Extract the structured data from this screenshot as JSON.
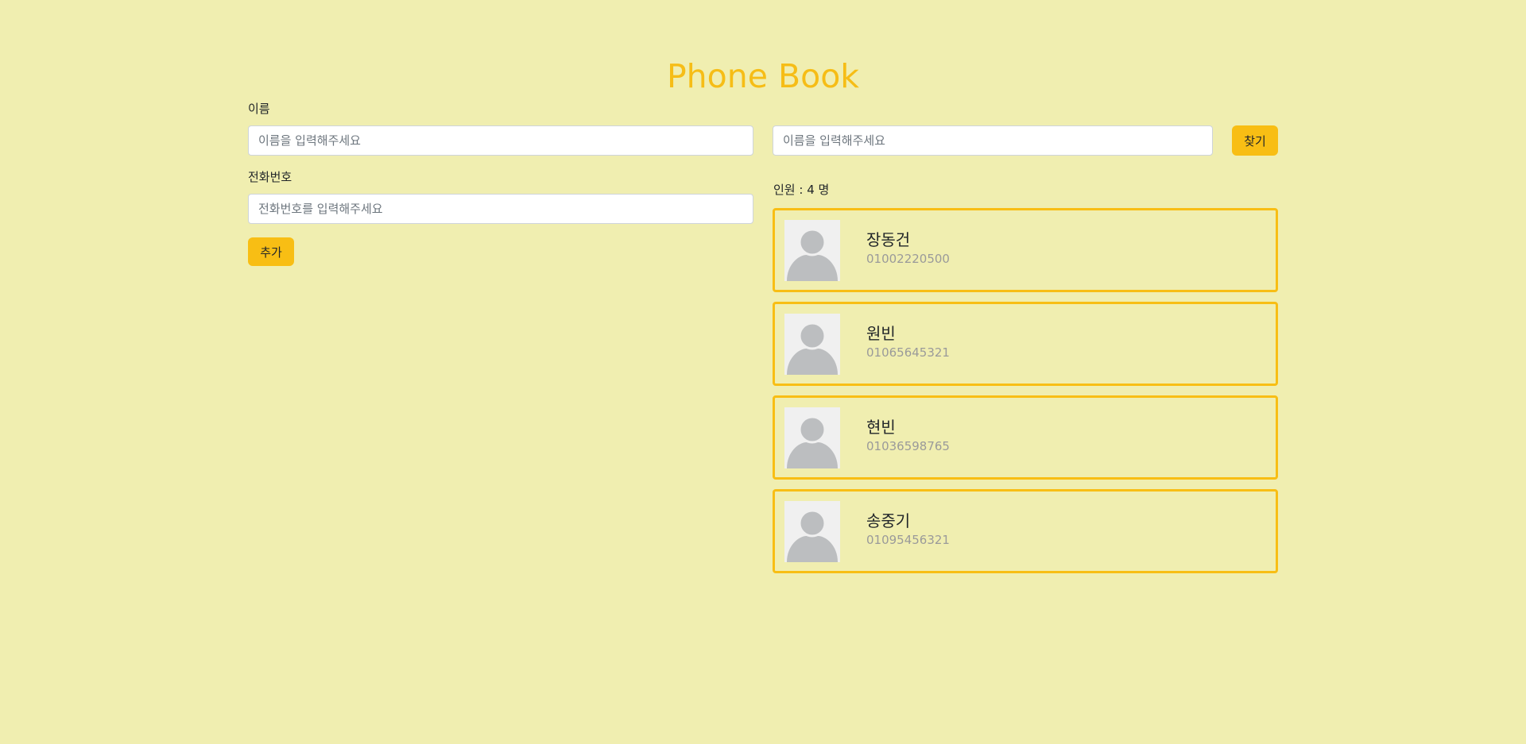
{
  "page": {
    "title": "Phone Book"
  },
  "form": {
    "name_label": "이름",
    "name_placeholder": "이름을 입력해주세요",
    "phone_label": "전화번호",
    "phone_placeholder": "전화번호를 입력해주세요",
    "add_label": "추가"
  },
  "search": {
    "placeholder": "이름을 입력해주세요",
    "button_label": "찾기"
  },
  "list": {
    "count_text": "인원 : 4 명",
    "contacts": [
      {
        "name": "장동건",
        "phone": "01002220500",
        "avatar_icon": "person-avatar-icon"
      },
      {
        "name": "원빈",
        "phone": "01065645321",
        "avatar_icon": "person-avatar-icon"
      },
      {
        "name": "현빈",
        "phone": "01036598765",
        "avatar_icon": "person-avatar-icon"
      },
      {
        "name": "송중기",
        "phone": "01095456321",
        "avatar_icon": "person-avatar-icon"
      }
    ]
  },
  "colors": {
    "background": "#f0eeb0",
    "accent": "#f8be14",
    "title": "#f6bd16",
    "phone_text": "#9a9a9a"
  }
}
